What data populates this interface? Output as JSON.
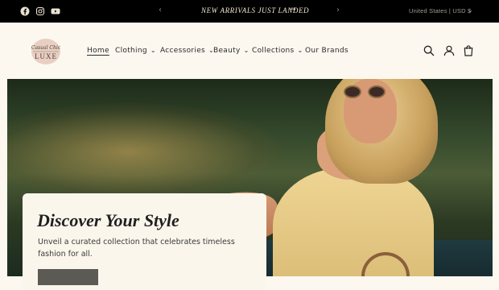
{
  "announcement": {
    "text": "NEW ARRIVALS JUST LANDED",
    "arrow": "→",
    "prev": "‹",
    "next": "›",
    "social": [
      "facebook-icon",
      "instagram-icon",
      "youtube-icon"
    ],
    "locale": "United States | USD $",
    "locale_chevron": "⌄"
  },
  "header": {
    "logo_text_top": "Casual Chic",
    "logo_text_bottom": "LUXE",
    "nav": [
      {
        "label": "Home",
        "active": true,
        "dropdown": false
      },
      {
        "label": "Clothing",
        "dropdown": true
      },
      {
        "label": "Accessories",
        "dropdown": true
      },
      {
        "label": "Beauty",
        "dropdown": true
      },
      {
        "label": "Collections",
        "dropdown": true
      },
      {
        "label": "Our Brands",
        "dropdown": false
      }
    ],
    "chevron": "⌄",
    "icons": [
      "search-icon",
      "account-icon",
      "cart-icon"
    ]
  },
  "hero": {
    "title": "Discover Your Style",
    "text": "Unveil a curated collection that celebrates timeless fashion for all.",
    "button_label": ""
  },
  "colors": {
    "bar": "#000000",
    "page_bg": "#fdf8ef",
    "card_bg": "#fbf6ec",
    "button_bg": "#5b5a55"
  }
}
